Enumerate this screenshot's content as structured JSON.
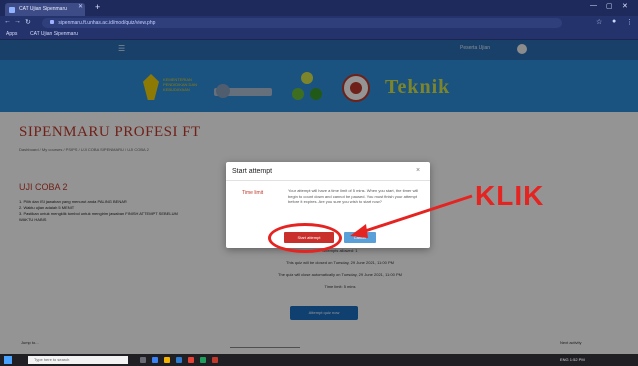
{
  "browser": {
    "tab_title": "CAT Ujian Sipenmaru",
    "new_tab": "+",
    "url": "sipenmaru.ft.unhas.ac.id/mod/quiz/view.php",
    "bookmarks": [
      "Apps",
      "CAT Ujian Sipenmaru"
    ],
    "window_controls": [
      "—",
      "▢",
      "✕"
    ]
  },
  "site": {
    "user_label": "Peserta Ujian",
    "brand_word": "Teknik",
    "kemdik_text": "KEMENTERIAN PENDIDIKAN DAN KEBUDAYAAN"
  },
  "page": {
    "title": "SIPENMARU PROFESI FT",
    "breadcrumb": "Dashboard / My courses / PSIPS / UJI COBA SIPENMARU / UJI COBA 2",
    "quiz_name": "UJI COBA 2",
    "description": [
      "1. Pilih dan ISI jawaban yang menurut anda PALING BENAR",
      "2. Waktu ujian adalah 5 MENIT",
      "3. Pastikan untuk mengklik tombol untuk mengirim jawaban FINISH ATTEMPT SEBELUM WAKTU HABIS"
    ],
    "info_lines": [
      "Attempts allowed: 1",
      "This quiz will be closed on Tuesday, 29 June 2021, 11:00 PM",
      "The quiz will close automatically on Tuesday, 29 June 2021, 11:00 PM",
      "Time limit: 5 mins"
    ],
    "attempt_button": "Attempt quiz now",
    "footer_left": "Jump to...",
    "footer_mid": "",
    "footer_right": "Next activity"
  },
  "modal": {
    "title": "Start attempt",
    "close": "×",
    "time_limit_label": "Time limit",
    "body": "Your attempt will have a time limit of 5 mins. When you start, the timer will begin to count down and cannot be paused. You must finish your attempt before it expires. Are you sure you wish to start now?",
    "start_button": "Start attempt",
    "cancel_button": "Cancel"
  },
  "annotation": {
    "label": "KLIK",
    "color": "#e52421"
  },
  "taskbar": {
    "search_placeholder": "Type here to search",
    "tray": "ENG  1:52 PM"
  }
}
